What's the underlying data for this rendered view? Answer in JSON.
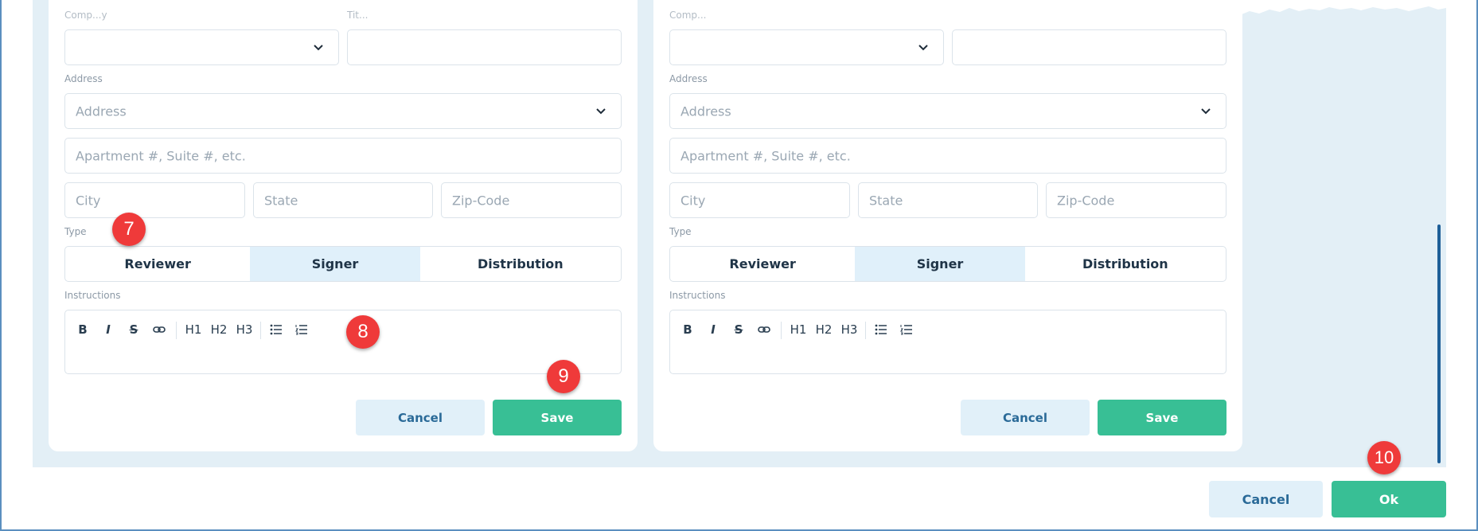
{
  "contact_forms": [
    {
      "company_label": "Comp...y",
      "title_label": "Tit...",
      "address_label": "Address",
      "address_placeholder": "Address",
      "apartment_placeholder": "Apartment #, Suite #, etc.",
      "city_placeholder": "City",
      "state_placeholder": "State",
      "zip_placeholder": "Zip-Code",
      "type_label": "Type",
      "type_options": [
        "Reviewer",
        "Signer",
        "Distribution"
      ],
      "selected_type": "Signer",
      "instructions_label": "Instructions",
      "toolbar": [
        "B",
        "I",
        "S",
        "link",
        "H1",
        "H2",
        "H3",
        "bullet-list",
        "numbered-list"
      ],
      "cancel_label": "Cancel",
      "save_label": "Save"
    },
    {
      "company_label": "Comp...",
      "address_label": "Address",
      "address_placeholder": "Address",
      "apartment_placeholder": "Apartment #, Suite #, etc.",
      "city_placeholder": "City",
      "state_placeholder": "State",
      "zip_placeholder": "Zip-Code",
      "type_label": "Type",
      "type_options": [
        "Reviewer",
        "Signer",
        "Distribution"
      ],
      "selected_type": "Signer",
      "instructions_label": "Instructions",
      "toolbar": [
        "B",
        "I",
        "S",
        "link",
        "H1",
        "H2",
        "H3",
        "bullet-list",
        "numbered-list"
      ],
      "cancel_label": "Cancel",
      "save_label": "Save"
    }
  ],
  "footer": {
    "cancel_label": "Cancel",
    "ok_label": "Ok"
  },
  "annotations": [
    "7",
    "8",
    "9",
    "10"
  ],
  "colors": {
    "accent_green": "#38bf95",
    "cancel_bg": "#e1f0f9",
    "cancel_text": "#2a6a98",
    "panel_bg": "#e3eff6",
    "selected_segment": "#e0f0fa",
    "badge_red": "#ef3a3a"
  }
}
